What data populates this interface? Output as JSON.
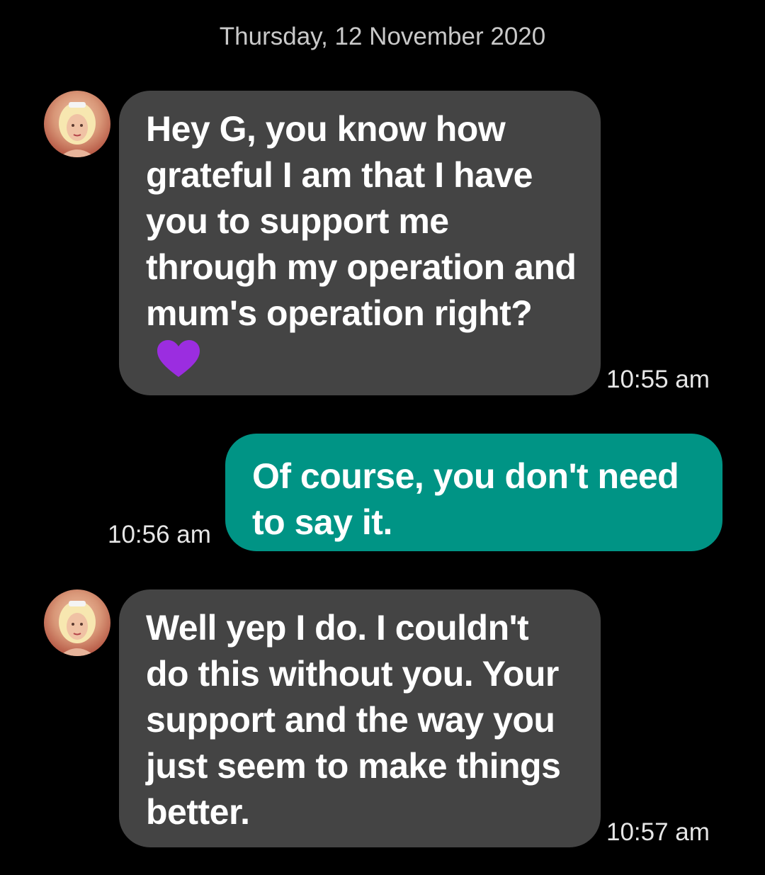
{
  "date_header": "Thursday, 12 November 2020",
  "messages": [
    {
      "direction": "incoming",
      "text": "Hey G, you know how grateful I am that I have you to support me through my operation and mum's operation right?",
      "emoji": "purple-heart-icon",
      "time": "10:55 am"
    },
    {
      "direction": "outgoing",
      "text": "Of course, you don't need to say it.",
      "time": "10:56 am"
    },
    {
      "direction": "incoming",
      "text": "Well yep I do. I couldn't do this without you. Your support and the way you just seem to make things better.",
      "time": "10:57 am"
    }
  ],
  "colors": {
    "background": "#000000",
    "incoming_bubble": "#444444",
    "outgoing_bubble": "#009485",
    "heart": "#9b2de0"
  }
}
